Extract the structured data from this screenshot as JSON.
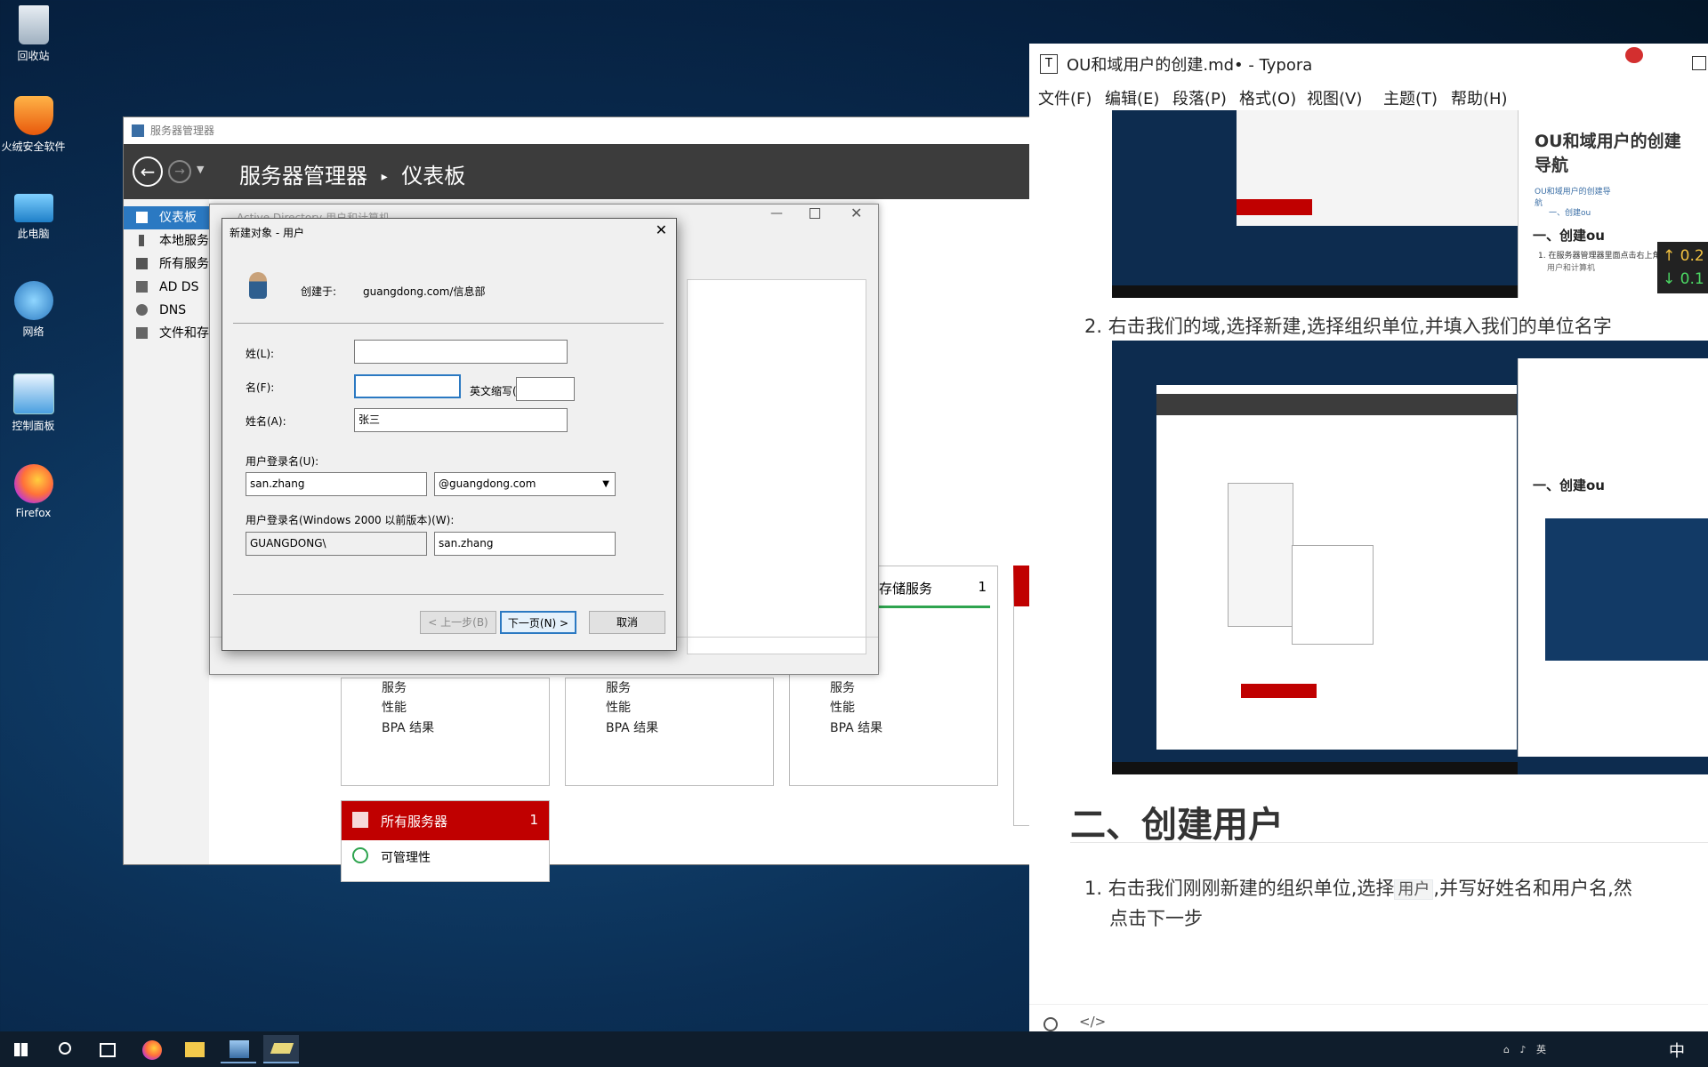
{
  "desktop": {
    "icons": [
      {
        "label": "回收站",
        "icon": "recycle-bin-icon"
      },
      {
        "label": "火绒安全软件",
        "icon": "huorong-shield-icon"
      },
      {
        "label": "此电脑",
        "icon": "computer-icon"
      },
      {
        "label": "网络",
        "icon": "network-icon"
      },
      {
        "label": "控制面板",
        "icon": "control-panel-icon"
      },
      {
        "label": "Firefox",
        "icon": "firefox-icon"
      }
    ]
  },
  "server_manager": {
    "window_title": "服务器管理器",
    "header_app": "服务器管理器",
    "header_page": "仪表板",
    "sidebar": [
      {
        "label": "仪表板",
        "selected": true
      },
      {
        "label": "本地服务"
      },
      {
        "label": "所有服务"
      },
      {
        "label": "AD DS"
      },
      {
        "label": "DNS"
      },
      {
        "label": "文件和存"
      }
    ],
    "tiles": [
      {
        "rows": [
          "服务",
          "性能",
          "BPA 结果"
        ]
      },
      {
        "rows": [
          "服务",
          "性能",
          "BPA 结果"
        ]
      },
      {
        "title": "存储服务",
        "count": "1",
        "rows": [
          "服务",
          "性能",
          "BPA 结果"
        ]
      }
    ],
    "all_servers": {
      "label": "所有服务器",
      "count": "1",
      "manageability": "可管理性"
    },
    "accent_red": "#c00000"
  },
  "ad_window": {
    "title": "Active Directory 用户和计算机"
  },
  "dialog": {
    "title": "新建对象 - 用户",
    "created_in_label": "创建于:",
    "created_in_value": "guangdong.com/信息部",
    "last_name_label": "姓(L):",
    "last_name_value": "",
    "first_name_label": "名(F):",
    "first_name_value": "",
    "initials_label": "英文缩写(I):",
    "initials_value": "",
    "full_name_label": "姓名(A):",
    "full_name_value": "张三",
    "logon_label": "用户登录名(U):",
    "logon_value": "san.zhang",
    "domain_value": "@guangdong.com",
    "pre2000_label": "用户登录名(Windows 2000 以前版本)(W):",
    "pre2000_domain": "GUANGDONG\\",
    "pre2000_value": "san.zhang",
    "back_button": "< 上一步(B)",
    "next_button": "下一页(N) >",
    "cancel_button": "取消"
  },
  "typora": {
    "title": "OU和域用户的创建.md• - Typora",
    "menu": [
      "文件(F)",
      "编辑(E)",
      "段落(P)",
      "格式(O)",
      "视图(V)",
      "主题(T)",
      "帮助(H)"
    ],
    "outline": {
      "title": "OU和域用户的创建导航",
      "link1": "OU和域用户的创建导航",
      "link2": "一、创建ou",
      "section": "一、创建ou",
      "item": "1. 在服务器管理器里面点击右上角",
      "item_cont": "用户和计算机"
    },
    "speed": {
      "up": "0.2",
      "down": "0.1"
    },
    "step2": "右击我们的域,选择新建,选择组织单位,并填入我们的单位名字",
    "h2": "二、创建用户",
    "step1_a": "右击我们刚刚新建的组织单位,选择",
    "step1_code": "用户",
    "step1_b": ",并写好姓名和用户名,然",
    "step1_c": "点击下一步"
  },
  "taskbar": {
    "tray_lang": "英",
    "tray_ime": "中"
  }
}
